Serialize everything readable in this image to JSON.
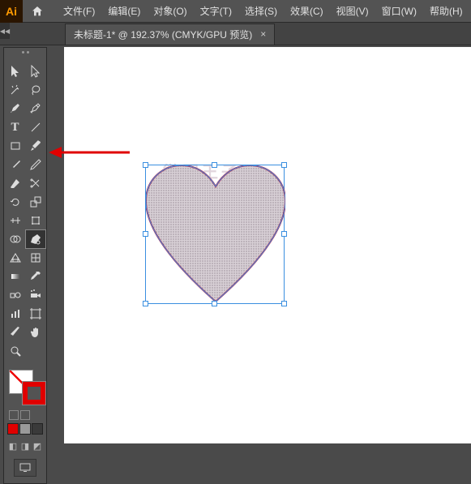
{
  "app": {
    "logo": "Ai"
  },
  "menu": {
    "file": "文件(F)",
    "edit": "编辑(E)",
    "object": "对象(O)",
    "type": "文字(T)",
    "select": "选择(S)",
    "effect": "效果(C)",
    "view": "视图(V)",
    "window": "窗口(W)",
    "help": "帮助(H)"
  },
  "document": {
    "tab_title": "未标题-1* @ 192.37% (CMYK/GPU 预览)",
    "close_glyph": "×"
  },
  "tools": {
    "selection": "selection",
    "direct_selection": "direct-selection",
    "magic_wand": "magic-wand",
    "lasso": "lasso",
    "pen": "pen",
    "curvature": "curvature",
    "type": "type",
    "line": "line",
    "rectangle": "rectangle",
    "paintbrush": "paintbrush",
    "pencil": "pencil",
    "shaper": "shaper",
    "eraser": "eraser",
    "rotate": "rotate",
    "scale": "scale",
    "width": "width",
    "free_transform": "free-transform",
    "shape_builder": "shape-builder",
    "perspective": "perspective",
    "mesh": "mesh",
    "gradient": "gradient",
    "eyedropper": "eyedropper",
    "blend": "blend",
    "symbol_sprayer": "symbol-sprayer",
    "column_graph": "column-graph",
    "artboard": "artboard",
    "slice": "slice",
    "hand": "hand",
    "zoom": "zoom"
  },
  "colors": {
    "fill": "none",
    "stroke": "#e00000",
    "swatches": [
      "#e00000",
      "#9a9a9a",
      "#3a3a3a"
    ]
  },
  "watermark": "微图王子网"
}
